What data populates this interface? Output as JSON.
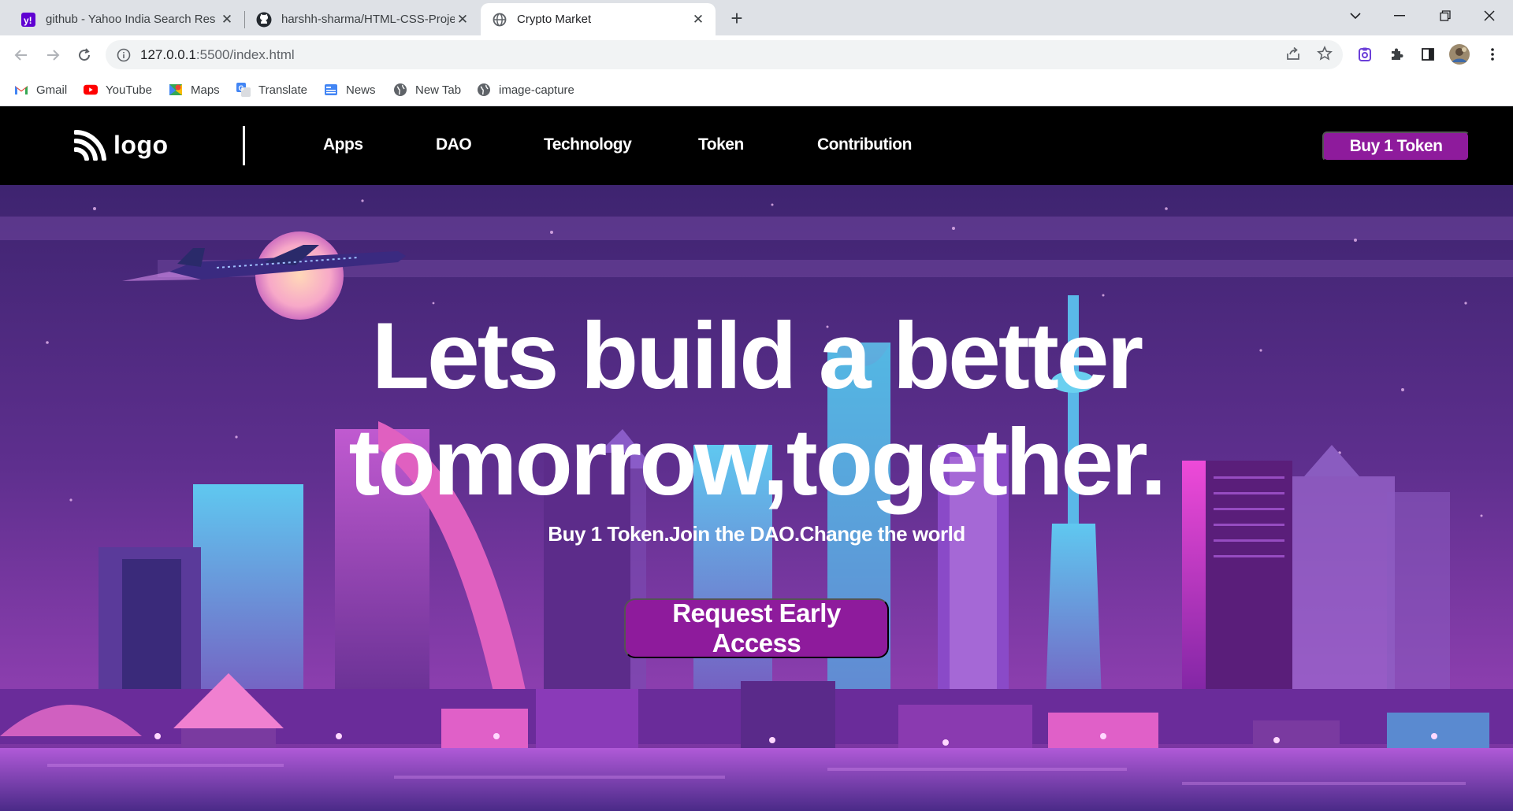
{
  "browser": {
    "tabs": [
      {
        "title": "github - Yahoo India Search Res",
        "icon": "yahoo-icon"
      },
      {
        "title": "harshh-sharma/HTML-CSS-Proje",
        "icon": "github-icon"
      },
      {
        "title": "Crypto Market",
        "icon": "globe-icon",
        "active": true
      }
    ],
    "url_host": "127.0.0.1",
    "url_path": ":5500/index.html",
    "bookmarks": [
      {
        "label": "Gmail",
        "icon": "gmail-icon"
      },
      {
        "label": "YouTube",
        "icon": "youtube-icon"
      },
      {
        "label": "Maps",
        "icon": "maps-icon"
      },
      {
        "label": "Translate",
        "icon": "translate-icon"
      },
      {
        "label": "News",
        "icon": "news-icon"
      },
      {
        "label": "New Tab",
        "icon": "globe-icon"
      },
      {
        "label": "image-capture",
        "icon": "globe-icon"
      }
    ]
  },
  "site": {
    "logo_text": "logo",
    "nav": [
      "Apps",
      "DAO",
      "Technology",
      "Token",
      "Contribution"
    ],
    "buy_button": "Buy 1 Token",
    "hero_title_line1": "Lets build a better",
    "hero_title_line2": "tomorrow,together.",
    "hero_subtitle": "Buy 1 Token.Join the DAO.Change the world",
    "hero_cta": "Request Early Access"
  },
  "colors": {
    "accent": "#8e1b9c",
    "nav_bg": "#000000",
    "sky_top": "#4b2a78",
    "sky_bottom": "#7a3aa8"
  }
}
